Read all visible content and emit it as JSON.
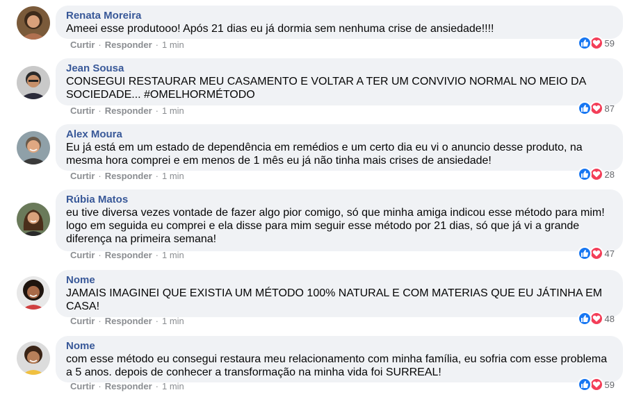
{
  "colors": {
    "name": "#385898",
    "bubble": "#f0f2f5",
    "like": "#1877f2",
    "love": "#f33e58",
    "meta": "#8a8d91"
  },
  "comments": [
    {
      "name": "Renata Moreira",
      "text": "Ameei esse produtooo! Após 21 dias eu já dormia sem nenhuma crise de ansiedade!!!!",
      "like_label": "Curtir",
      "reply_label": "Responder",
      "time": "1 min",
      "reactions": "59",
      "avatar_icon": "avatar-woman-curly"
    },
    {
      "name": "Jean Sousa",
      "text": "CONSEGUI RESTAURAR MEU CASAMENTO E VOLTAR A TER UM CONVIVIO NORMAL NO MEIO DA SOCIEDADE... #OMELHORMÉTODO",
      "like_label": "Curtir",
      "reply_label": "Responder",
      "time": "1 min",
      "reactions": "87",
      "avatar_icon": "avatar-man-glasses"
    },
    {
      "name": "Alex Moura",
      "text": "Eu já está em um estado de dependência em remédios e um certo dia eu vi o anuncio desse produto, na mesma hora comprei e em menos de 1 mês eu já não tinha mais crises de ansiedade!",
      "like_label": "Curtir",
      "reply_label": "Responder",
      "time": "1 min",
      "reactions": "28",
      "avatar_icon": "avatar-man-smiling"
    },
    {
      "name": "Rúbia Matos",
      "text": "eu tive diversa vezes vontade de fazer algo pior comigo, só que minha amiga indicou esse método para mim! logo em seguida eu comprei e ela disse para mim seguir esse método por 21 dias, só que já vi a grande diferença na primeira semana!",
      "like_label": "Curtir",
      "reply_label": "Responder",
      "time": "1 min",
      "reactions": "47",
      "avatar_icon": "avatar-woman-long-hair"
    },
    {
      "name": "Nome",
      "text": "JAMAIS IMAGINEI QUE EXISTIA UM MÉTODO 100% NATURAL E COM MATERIAS QUE EU JÁTINHA EM CASA!",
      "like_label": "Curtir",
      "reply_label": "Responder",
      "time": "1 min",
      "reactions": "48",
      "avatar_icon": "avatar-woman-dark-curly"
    },
    {
      "name": "Nome",
      "text": "com esse método eu consegui restaura meu relacionamento com minha família, eu sofria com esse problema a 5 anos. depois de conhecer a transformação na minha vida foi SURREAL!",
      "like_label": "Curtir",
      "reply_label": "Responder",
      "time": "1 min",
      "reactions": "59",
      "avatar_icon": "avatar-woman-smiling"
    }
  ]
}
